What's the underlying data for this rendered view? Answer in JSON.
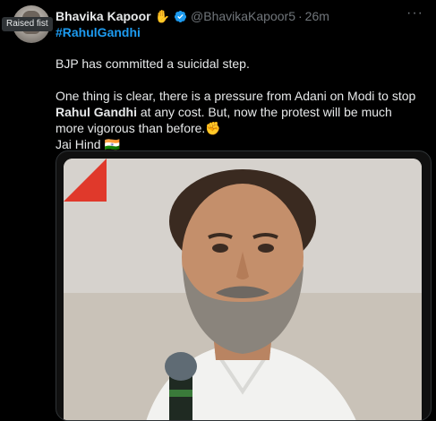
{
  "tooltip": "Raised fist",
  "author": {
    "name": "Bhavika Kapoor",
    "name_emoji": "✋",
    "handle": "@BhavikaKapoor5",
    "separator": "·",
    "time": "26m"
  },
  "more_label": "···",
  "hashtag": "#RahulGandhi",
  "body": {
    "line1": "BJP has committed a suicidal step.",
    "line2_pre": "One thing is clear, there is a pressure from Adani on Modi to stop ",
    "line2_bold": "Rahul Gandhi",
    "line2_post": " at any cost.  But, now the protest will be much more vigorous than before.",
    "line2_emoji": "✊",
    "line3": "Jai Hind",
    "line3_emoji": "🇮🇳"
  },
  "colors": {
    "background": "#000000",
    "text": "#e7e9ea",
    "muted": "#71767b",
    "link": "#1d9bf0",
    "verified": "#1d9bf0",
    "flag": "#e0392b"
  },
  "icons": {
    "verified": "verified-badge-icon",
    "more": "more-options-icon",
    "corner": "red-corner-flag-icon"
  }
}
